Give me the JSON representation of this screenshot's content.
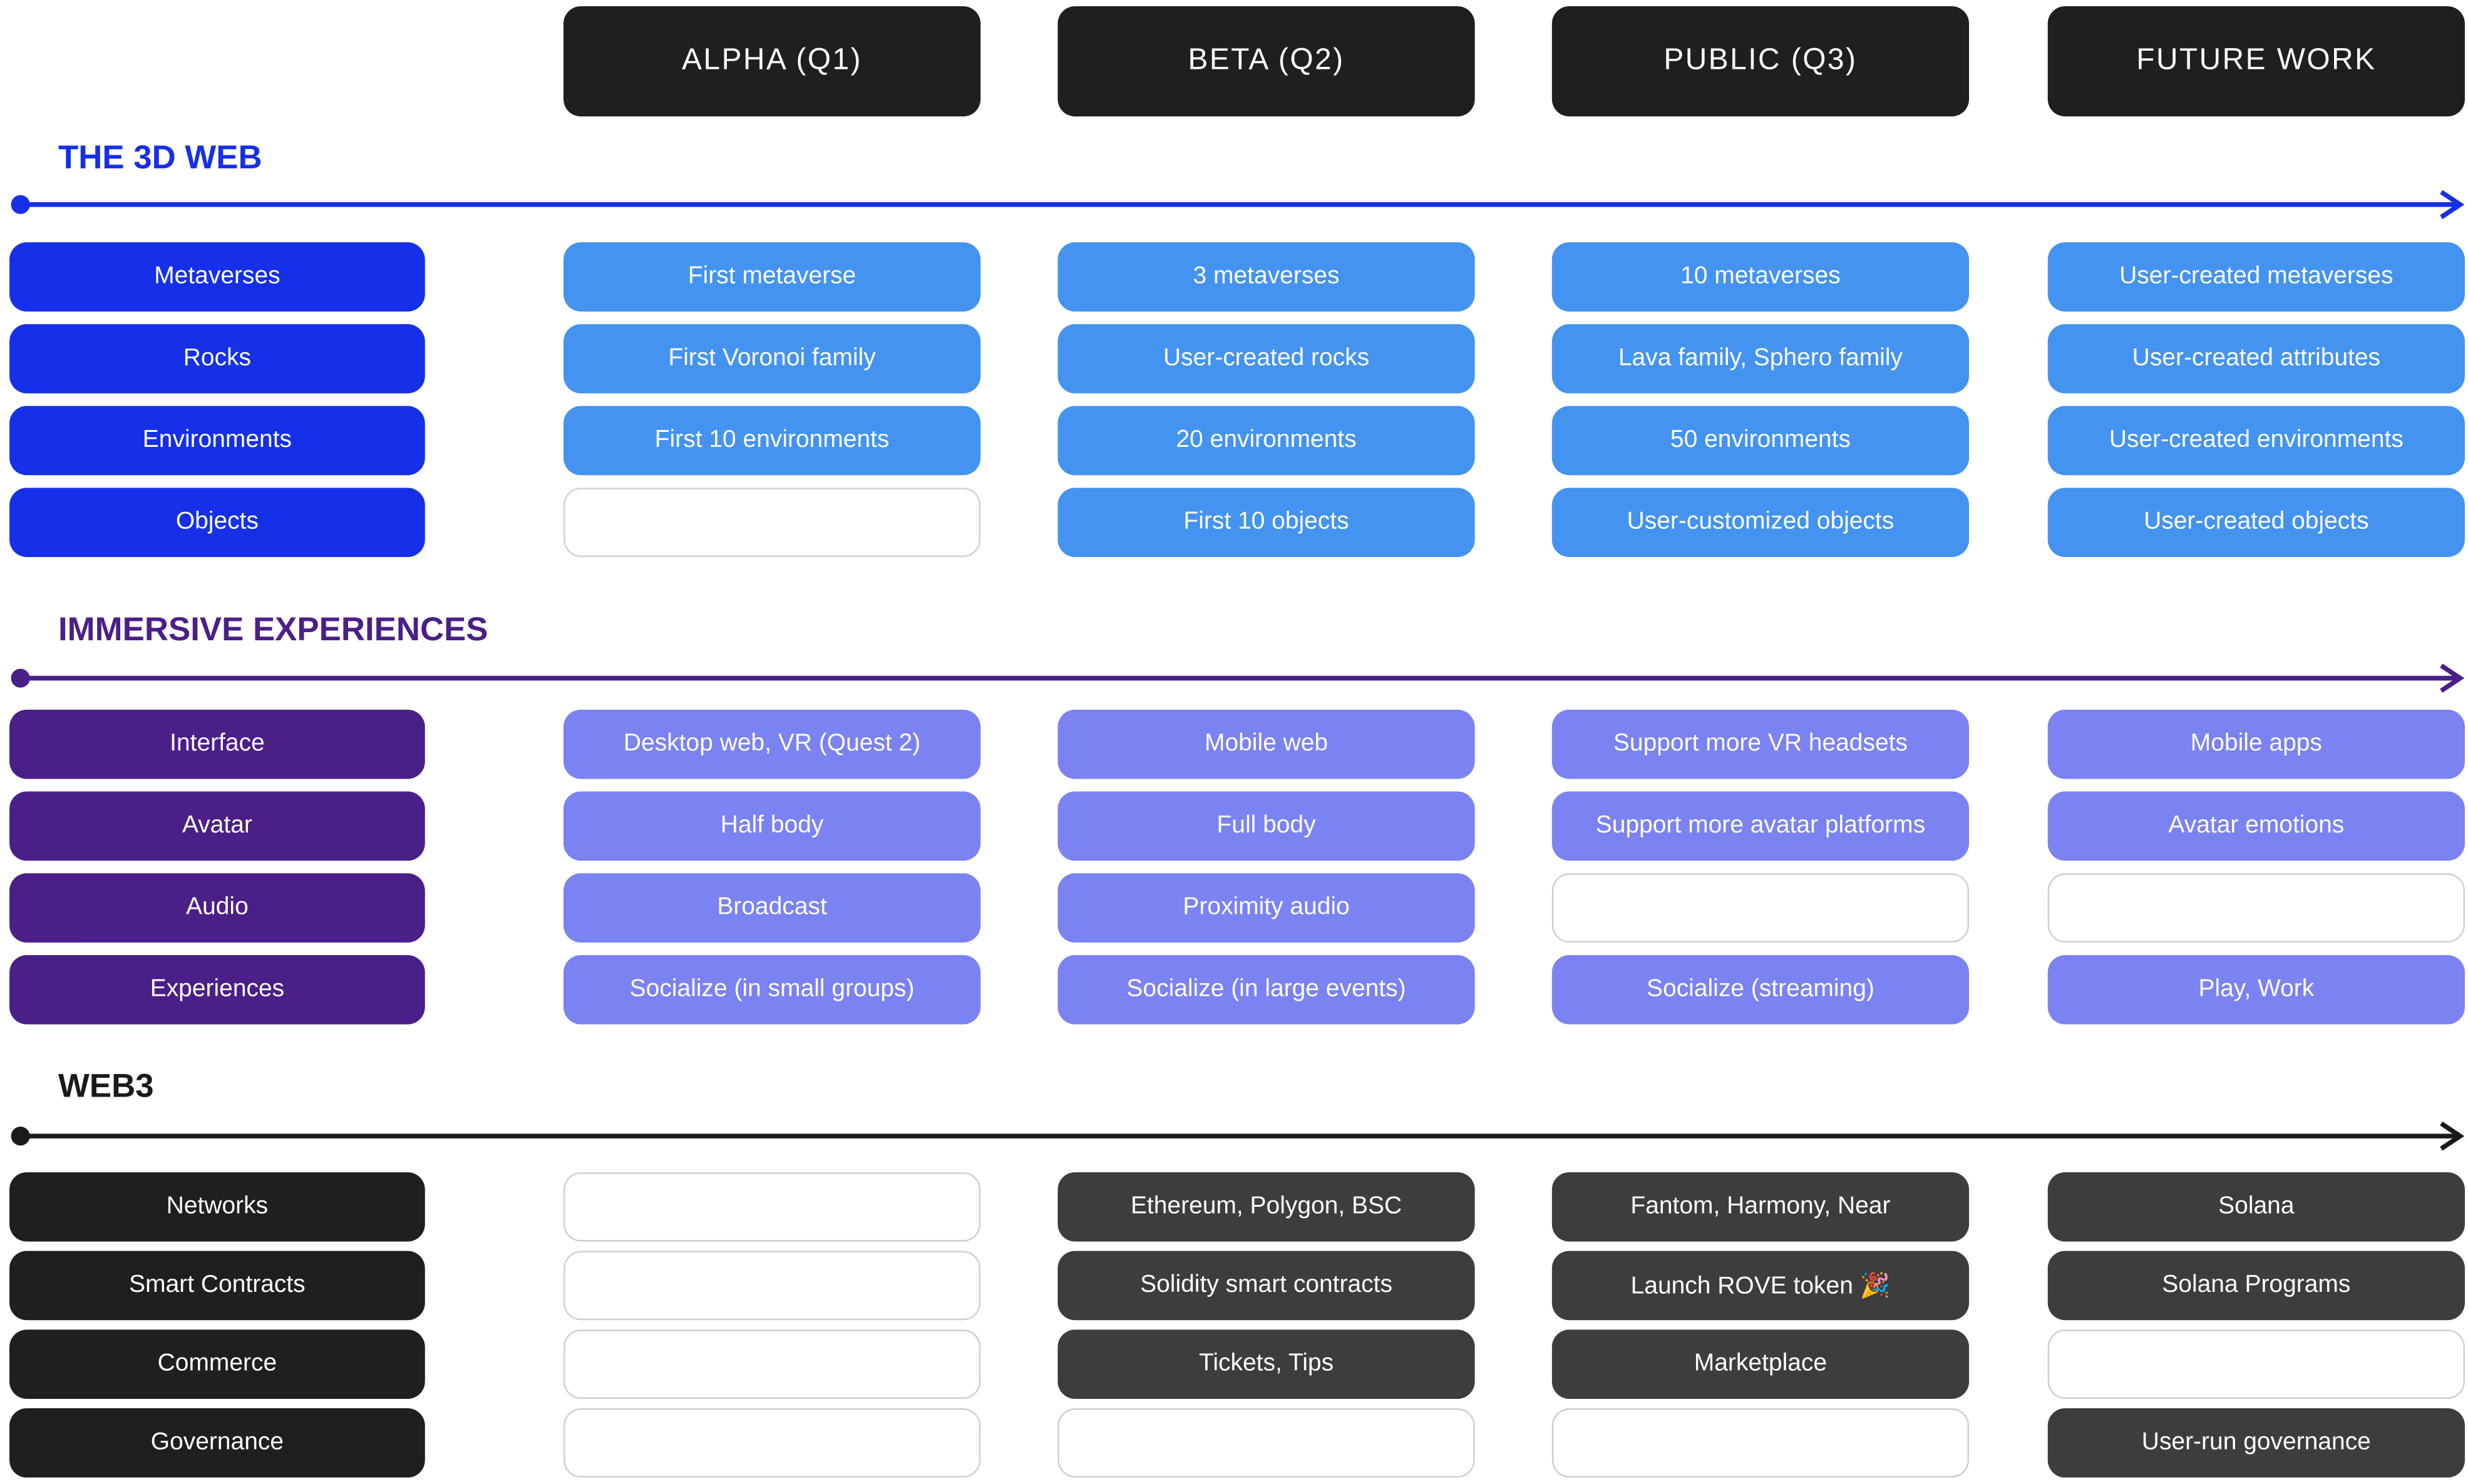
{
  "colors": {
    "phase_bg": "#1f1f1f",
    "web3d_title": "#1530e8",
    "web3d_label": "#1530e8",
    "web3d_cell": "#4493f0",
    "immersive_title": "#4b1f88",
    "immersive_label": "#4b1f88",
    "immersive_cell": "#7b82f2",
    "web3_title": "#1a1a1a",
    "web3_label": "#1f1f1f",
    "web3_cell": "#3d3d3d",
    "empty_border": "#cfcfcf"
  },
  "phases": [
    "ALPHA (Q1)",
    "BETA (Q2)",
    "PUBLIC (Q3)",
    "FUTURE WORK"
  ],
  "sections": [
    {
      "title": "THE 3D WEB",
      "theme": "web3d",
      "rows": [
        {
          "label": "Metaverses",
          "cells": [
            "First metaverse",
            "3 metaverses",
            "10 metaverses",
            "User-created metaverses"
          ]
        },
        {
          "label": "Rocks",
          "cells": [
            "First Voronoi family",
            "User-created rocks",
            "Lava family, Sphero family",
            "User-created attributes"
          ]
        },
        {
          "label": "Environments",
          "cells": [
            "First 10 environments",
            "20 environments",
            "50 environments",
            "User-created environments"
          ]
        },
        {
          "label": "Objects",
          "cells": [
            "",
            "First 10 objects",
            "User-customized objects",
            "User-created objects"
          ]
        }
      ]
    },
    {
      "title": "IMMERSIVE EXPERIENCES",
      "theme": "immersive",
      "rows": [
        {
          "label": "Interface",
          "cells": [
            "Desktop web, VR (Quest 2)",
            "Mobile web",
            "Support more VR headsets",
            "Mobile apps"
          ]
        },
        {
          "label": "Avatar",
          "cells": [
            "Half body",
            "Full body",
            "Support more avatar platforms",
            "Avatar emotions"
          ]
        },
        {
          "label": "Audio",
          "cells": [
            "Broadcast",
            "Proximity audio",
            "",
            ""
          ]
        },
        {
          "label": "Experiences",
          "cells": [
            "Socialize (in small groups)",
            "Socialize (in large events)",
            "Socialize (streaming)",
            "Play, Work"
          ]
        }
      ]
    },
    {
      "title": "WEB3",
      "theme": "web3",
      "rows": [
        {
          "label": "Networks",
          "cells": [
            "",
            "Ethereum, Polygon, BSC",
            "Fantom, Harmony, Near",
            "Solana"
          ]
        },
        {
          "label": "Smart Contracts",
          "cells": [
            "",
            "Solidity smart contracts",
            "Launch ROVE token 🎉",
            "Solana Programs"
          ]
        },
        {
          "label": "Commerce",
          "cells": [
            "",
            "Tickets, Tips",
            "Marketplace",
            ""
          ]
        },
        {
          "label": "Governance",
          "cells": [
            "",
            "",
            "",
            "User-run governance"
          ]
        }
      ]
    }
  ]
}
